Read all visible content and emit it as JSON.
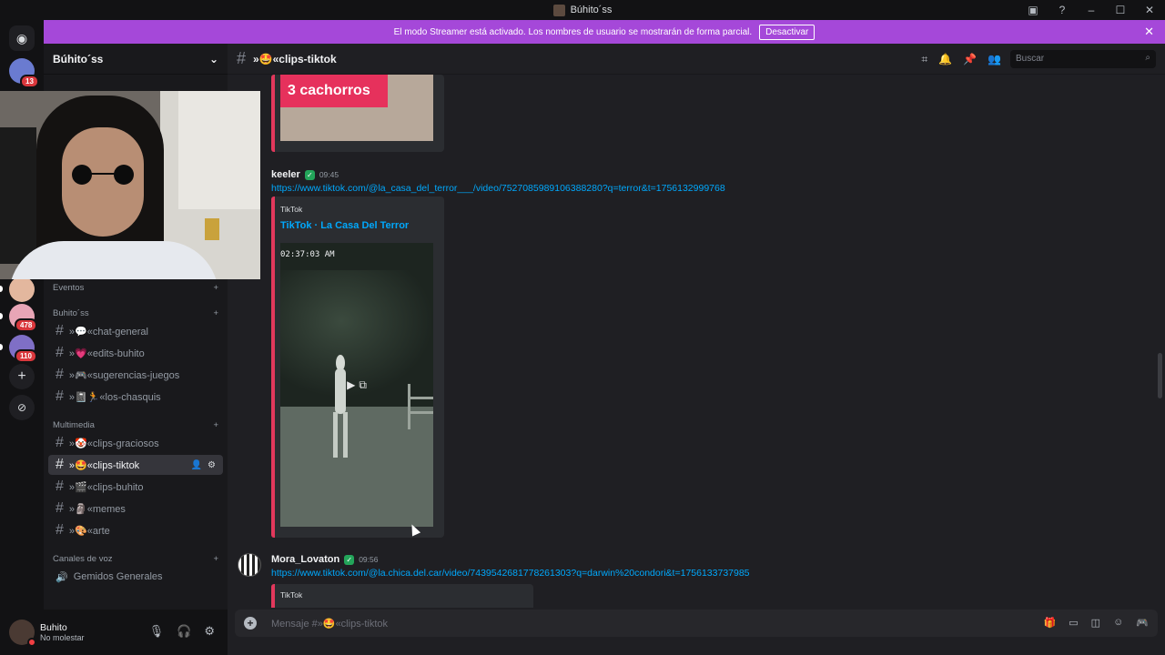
{
  "window": {
    "title": "Búhito´ss"
  },
  "banner": {
    "text": "El modo Streamer está activado. Los nombres de usuario se mostrarán de forma parcial.",
    "button": "Desactivar"
  },
  "rail": {
    "badges": [
      "13",
      "478",
      "110"
    ]
  },
  "server": {
    "name": "Búhito´ss"
  },
  "categories": {
    "events": "Eventos",
    "main": "Buhito´ss",
    "multimedia": "Multimedia",
    "voice": "Canales de voz"
  },
  "channels": [
    {
      "emoji": "💬",
      "name": "»💬«chat-general"
    },
    {
      "emoji": "💗",
      "name": "»💗«edits-buhito"
    },
    {
      "emoji": "🎮",
      "name": "»🎮«sugerencias-juegos"
    },
    {
      "emoji": "📓",
      "name": "»📓🏃«los-chasquis"
    },
    {
      "emoji": "🤡",
      "name": "»🤡«clips-graciosos"
    },
    {
      "emoji": "🤩",
      "name": "»🤩«clips-tiktok"
    },
    {
      "emoji": "🎬",
      "name": "»🎬«clips-buhito"
    },
    {
      "emoji": "🗿",
      "name": "»🗿«memes"
    },
    {
      "emoji": "🎨",
      "name": "»🎨«arte"
    }
  ],
  "voice_channel": "Gemidos Generales",
  "user": {
    "name": "Buhito",
    "status": "No molestar"
  },
  "header": {
    "channel": "»🤩«clips-tiktok",
    "search_placeholder": "Buscar"
  },
  "messages": [
    {
      "card_label": "3 cachorros"
    },
    {
      "author": "keeler",
      "time": "09:45",
      "link": "https://www.tiktok.com/@la_casa_del_terror___/video/7527085989106388280?q=terror&t=1756132999768",
      "provider": "TikTok",
      "embed_title": "TikTok · La Casa Del Terror",
      "video_timestamp": "02:37:03 AM"
    },
    {
      "author": "Mora_Lovaton",
      "time": "09:56",
      "link": "https://www.tiktok.com/@la.chica.del.car/video/7439542681778261303?q=darwin%20condori&t=1756133737985",
      "provider": "TikTok"
    }
  ],
  "composer": {
    "placeholder": "Mensaje #»🤩«clips-tiktok"
  }
}
